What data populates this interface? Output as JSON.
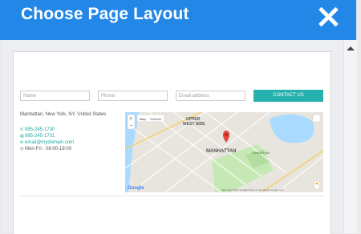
{
  "header": {
    "title": "Choose Page Layout"
  },
  "form": {
    "name_placeholder": "Name",
    "phone_placeholder": "Phone",
    "email_placeholder": "Email address",
    "contact_button": "CONTACT US"
  },
  "contact": {
    "address": "Manhattan, New York, NY, United States",
    "phone1": "985-245-1730",
    "phone2": "985-245-1731",
    "email": "email@mydomain.com",
    "hours": "Mon-Fri - 08:00-19:00"
  },
  "map": {
    "map_label": "Map",
    "satellite_label": "Satellite",
    "area_upper_west": "UPPER",
    "area_upper_west2": "WEST SIDE",
    "area_manhattan": "MANHATTAN",
    "central_park": "Central Park",
    "google": "Google",
    "footer": "Map data ©2017 Google   Terms of Use   Report a map error"
  },
  "colors": {
    "header": "#2387e8",
    "accent": "#26b1ae",
    "link": "#1fa89f"
  }
}
